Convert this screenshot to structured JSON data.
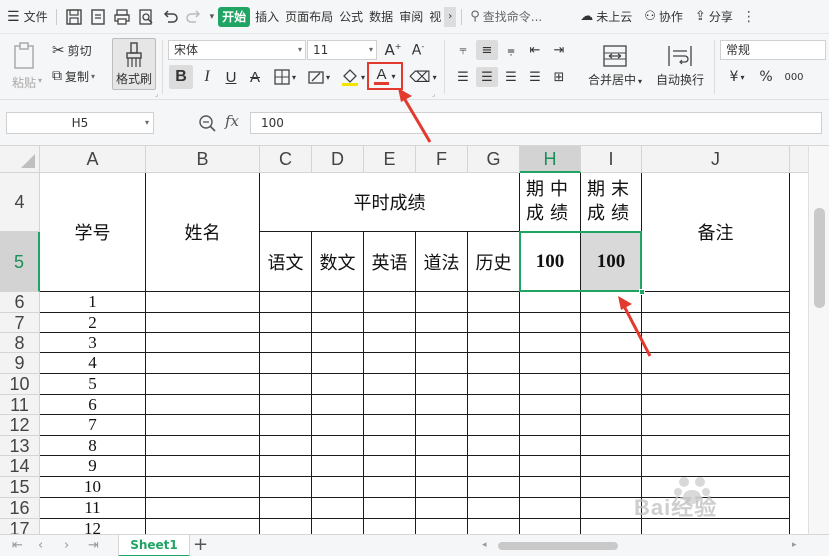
{
  "menubar": {
    "file_label": "文件",
    "tabs": [
      "开始",
      "插入",
      "页面布局",
      "公式",
      "数据",
      "审阅",
      "视"
    ],
    "search_placeholder": "查找命令...",
    "cloud_label": "未上云",
    "collab_label": "协作",
    "share_label": "分享"
  },
  "ribbon": {
    "paste_label": "粘贴",
    "cut_label": "剪切",
    "copy_label": "复制",
    "format_painter_label": "格式刷",
    "font_name": "宋体",
    "font_size": "11",
    "bold": "B",
    "italic": "I",
    "underline": "U",
    "strike": "A",
    "font_color": "A",
    "merge_label": "合并居中",
    "wrap_label": "自动换行",
    "number_format": "常规",
    "currency": "¥",
    "percent": "%",
    "thousands": "000"
  },
  "formula_bar": {
    "name_box": "H5",
    "fx_label": "fx",
    "value": "100"
  },
  "grid": {
    "columns": [
      "A",
      "B",
      "C",
      "D",
      "E",
      "F",
      "G",
      "H",
      "I",
      "J"
    ],
    "rows": [
      "4",
      "5",
      "6",
      "7",
      "8",
      "9",
      "10",
      "11",
      "12",
      "13",
      "14",
      "15",
      "16",
      "17"
    ],
    "selected_column": "H",
    "selected_row": "5",
    "header": {
      "student_id": "学号",
      "name": "姓名",
      "regular_score": "平时成绩",
      "midterm_line1": "期中",
      "midterm_line2": "成绩",
      "final_line1": "期末",
      "final_line2": "成绩",
      "remarks": "备注",
      "subjects": [
        "语文",
        "数文",
        "英语",
        "道法",
        "历史"
      ],
      "midterm_value": "100",
      "final_value": "100"
    },
    "student_numbers": [
      "1",
      "2",
      "3",
      "4",
      "5",
      "6",
      "7",
      "8",
      "9",
      "10",
      "11",
      "12"
    ]
  },
  "sheetbar": {
    "sheet_name": "Sheet1",
    "add_label": "+"
  },
  "watermark": {
    "text": "Bai经验"
  },
  "colors": {
    "accent": "#1fa463",
    "annotation": "#e23a2e",
    "selected_fill": "#d9d9d9"
  }
}
